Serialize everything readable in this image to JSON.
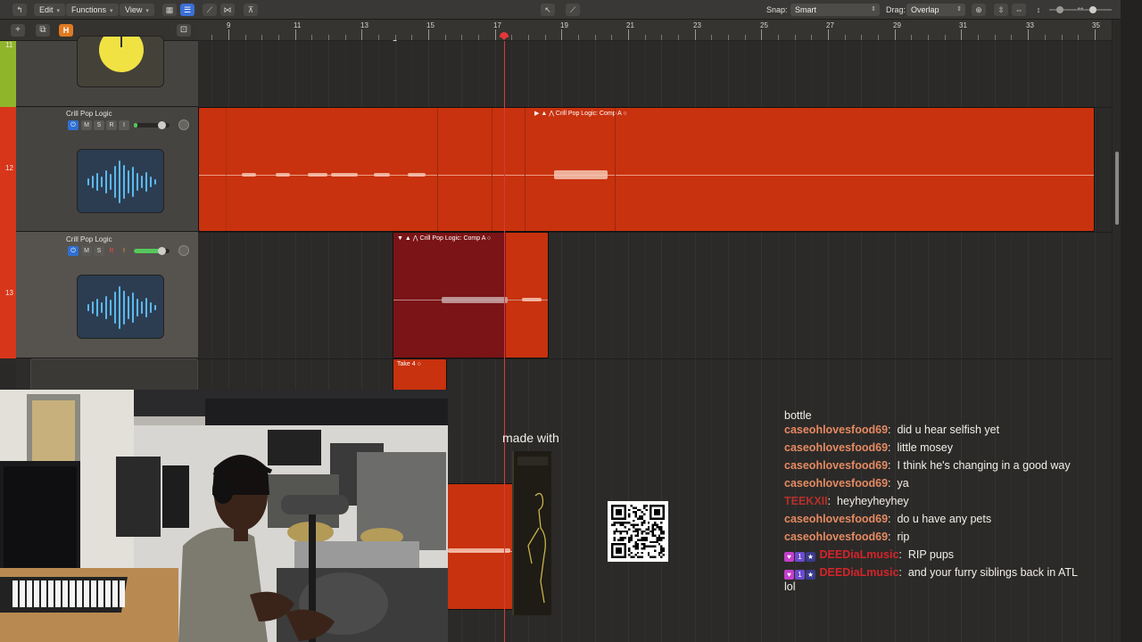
{
  "toolbar": {
    "edit_label": "Edit",
    "functions_label": "Functions",
    "view_label": "View",
    "snap_label": "Snap:",
    "snap_value": "Smart",
    "drag_label": "Drag:",
    "drag_value": "Overlap"
  },
  "ruler": {
    "bars": [
      "9",
      "11",
      "13",
      "15",
      "17",
      "19",
      "21",
      "23",
      "25",
      "27",
      "29",
      "31",
      "33",
      "35"
    ]
  },
  "header_toolbar": {
    "h_label": "H"
  },
  "tracks": [
    {
      "number": "11",
      "name": ""
    },
    {
      "number": "12",
      "name": "Crill Pop Logic",
      "buttons": {
        "mute": "M",
        "solo": "S",
        "record": "R",
        "input": "I"
      }
    },
    {
      "number": "13",
      "name": "Crill Pop Logic",
      "buttons": {
        "mute": "M",
        "solo": "S",
        "record": "R",
        "input": "I"
      }
    }
  ],
  "regions": {
    "track12_title": "Crill Pop Logic: Comp A",
    "track13_title": "Crill Pop Logic: Comp A",
    "take_title": "Take 4"
  },
  "overlay": {
    "made_with": "made with"
  },
  "chat": {
    "top_fragment": "bottle",
    "messages": [
      {
        "user": "caseohlovesfood69",
        "text": "did u hear selfish yet"
      },
      {
        "user": "caseohlovesfood69",
        "text": "little mosey"
      },
      {
        "user": "caseohlovesfood69",
        "text": "I think he's changing in a good way"
      },
      {
        "user": "caseohlovesfood69",
        "text": "ya"
      },
      {
        "user": "TEEKXII",
        "text": "heyheyheyhey"
      },
      {
        "user": "caseohlovesfood69",
        "text": "do u have any pets"
      },
      {
        "user": "caseohlovesfood69",
        "text": "rip"
      },
      {
        "user": "DEEDiaLmusic",
        "text": "RIP pups"
      },
      {
        "user": "DEEDiaLmusic",
        "text": "and your furry siblings back in ATL lol"
      }
    ]
  },
  "colors": {
    "region_orange": "#c8320e",
    "region_dark": "#7a1416",
    "playhead": "#d33b3b",
    "chat_user": "#e58a62",
    "chat_user_alt": "#d4242a"
  }
}
